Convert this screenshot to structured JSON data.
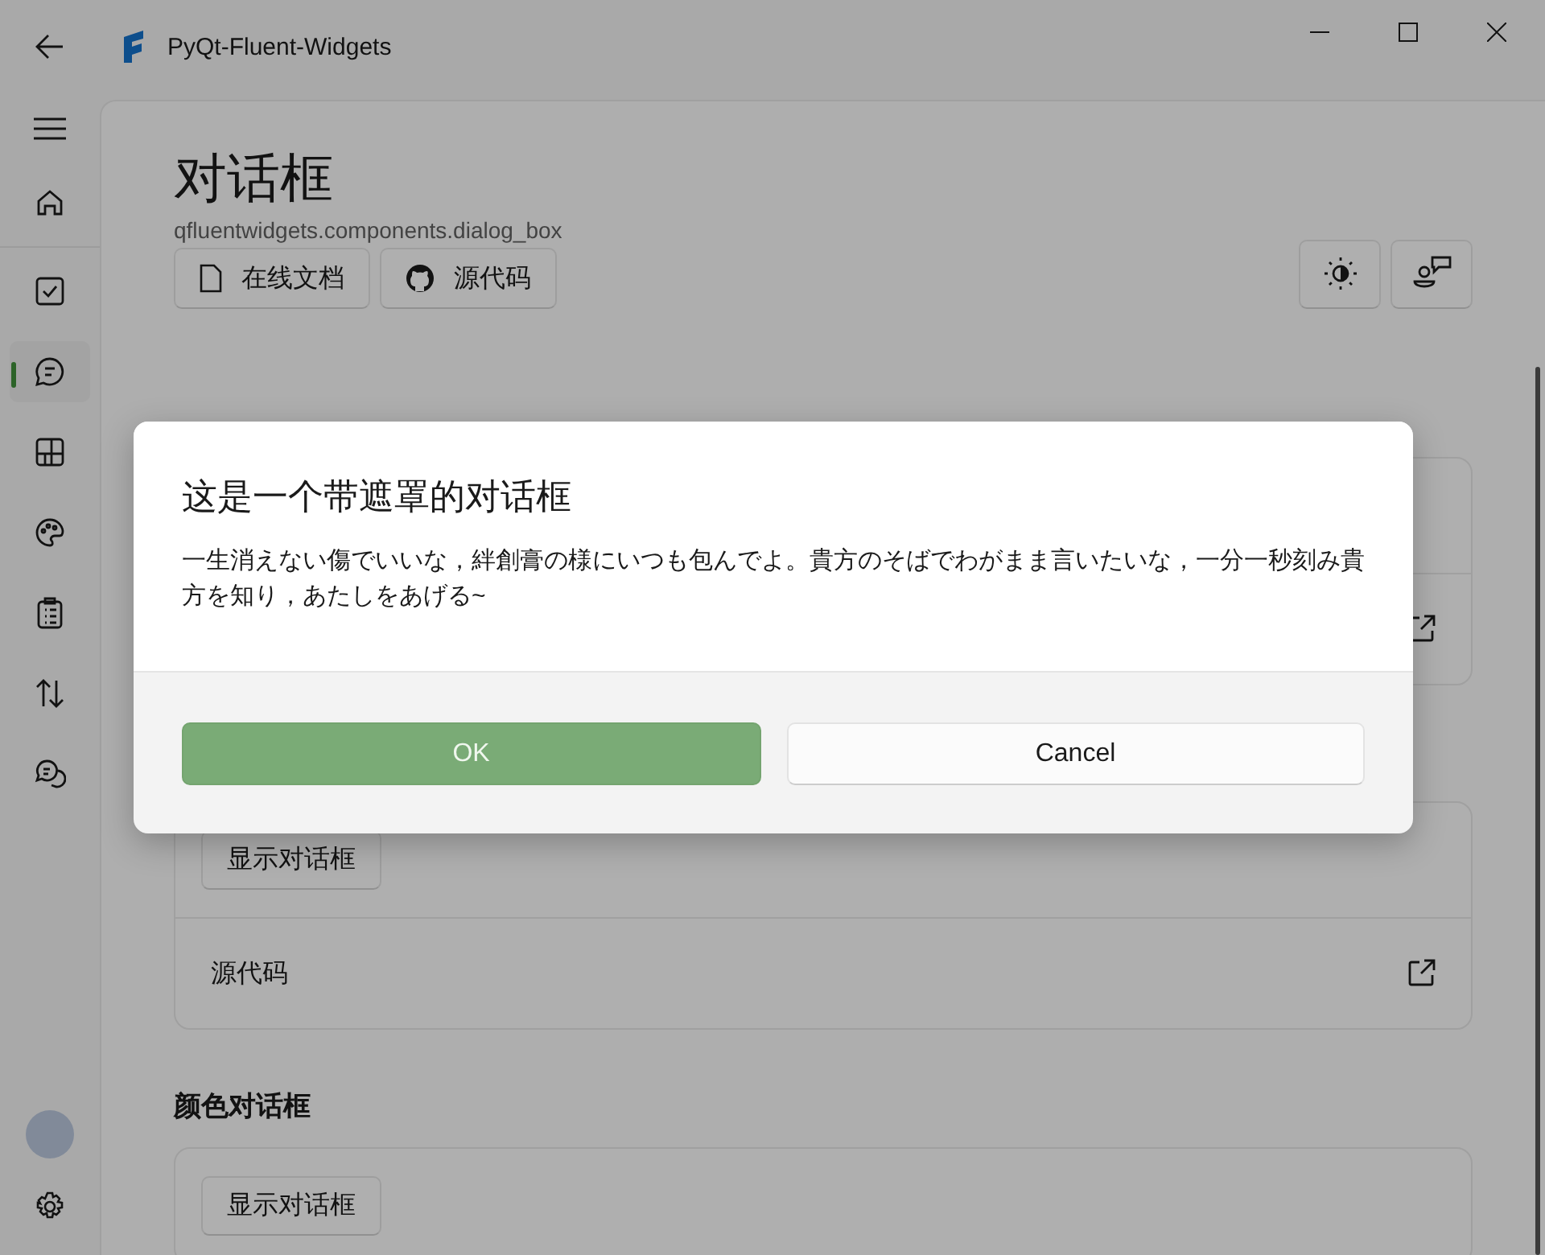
{
  "window": {
    "title": "PyQt-Fluent-Widgets"
  },
  "nav_items": [
    {
      "selected": false
    },
    {
      "selected": false
    },
    {
      "selected": true
    },
    {
      "selected": false
    },
    {
      "selected": false
    },
    {
      "selected": false
    },
    {
      "selected": false
    },
    {
      "selected": false
    }
  ],
  "page": {
    "title": "对话框",
    "subtitle": "qfluentwidgets.components.dialog_box",
    "links": [
      {
        "label": "在线文档",
        "kind": "doc"
      },
      {
        "label": "源代码",
        "kind": "github"
      }
    ],
    "blocks": [
      {
        "kind": "card",
        "source_row": true
      },
      {
        "kind": "card",
        "button": "显示对话框",
        "source_row": true,
        "source": "源代码"
      },
      {
        "kind": "heading",
        "text": "颜色对话框"
      },
      {
        "kind": "card",
        "button": "显示对话框",
        "source_row": false
      }
    ]
  },
  "dialog": {
    "title": "这是一个带遮罩的对话框",
    "body": "一生消えない傷でいいな，絆創膏の様にいつも包んでよ。貴方のそばでわがまま言いたいな，一分一秒刻み貴方を知り，あたしをあげる~",
    "buttons": [
      {
        "label": "OK",
        "kind": "primary"
      },
      {
        "label": "Cancel",
        "kind": "secondary"
      }
    ]
  }
}
